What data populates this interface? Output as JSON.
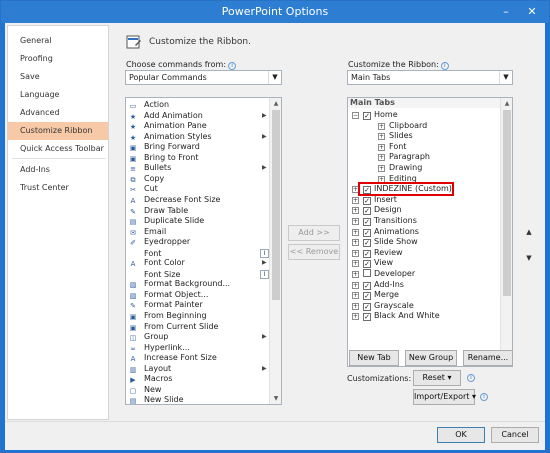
{
  "window": {
    "title": "PowerPoint Options",
    "minimize": "–",
    "close": "✕"
  },
  "sidebar": {
    "items": [
      {
        "label": "General"
      },
      {
        "label": "Proofing"
      },
      {
        "label": "Save"
      },
      {
        "label": "Language"
      },
      {
        "label": "Advanced"
      },
      {
        "label": "Customize Ribbon",
        "selected": true
      },
      {
        "label": "Quick Access Toolbar"
      },
      {
        "label": "Add-Ins"
      },
      {
        "label": "Trust Center"
      }
    ]
  },
  "main": {
    "heading": "Customize the Ribbon.",
    "choose_label": "Choose commands from:",
    "choose_value": "Popular Commands",
    "customize_label": "Customize the Ribbon:",
    "customize_value": "Main Tabs"
  },
  "commands": [
    {
      "label": "Action",
      "icon": "action-icon",
      "glyph": "▭"
    },
    {
      "label": "Add Animation",
      "icon": "star-icon",
      "glyph": "★",
      "submenu": true
    },
    {
      "label": "Animation Pane",
      "icon": "star-icon",
      "glyph": "★"
    },
    {
      "label": "Animation Styles",
      "icon": "star-icon",
      "glyph": "★",
      "submenu": true
    },
    {
      "label": "Bring Forward",
      "icon": "bring-forward-icon",
      "glyph": "▣"
    },
    {
      "label": "Bring to Front",
      "icon": "bring-front-icon",
      "glyph": "▣"
    },
    {
      "label": "Bullets",
      "icon": "bullets-icon",
      "glyph": "≡",
      "submenu": true
    },
    {
      "label": "Copy",
      "icon": "copy-icon",
      "glyph": "⧉"
    },
    {
      "label": "Cut",
      "icon": "scissors-icon",
      "glyph": "✂"
    },
    {
      "label": "Decrease Font Size",
      "icon": "decrease-font-icon",
      "glyph": "A"
    },
    {
      "label": "Draw Table",
      "icon": "pencil-icon",
      "glyph": "✎"
    },
    {
      "label": "Duplicate Slide",
      "icon": "slide-icon",
      "glyph": "▤"
    },
    {
      "label": "Email",
      "icon": "email-icon",
      "glyph": "✉"
    },
    {
      "label": "Eyedropper",
      "icon": "eyedropper-icon",
      "glyph": "✐"
    },
    {
      "label": "Font",
      "icon": "",
      "glyph": "",
      "control": "I"
    },
    {
      "label": "Font Color",
      "icon": "font-color-icon",
      "glyph": "A",
      "submenu": true
    },
    {
      "label": "Font Size",
      "icon": "",
      "glyph": "",
      "control": "I"
    },
    {
      "label": "Format Background...",
      "icon": "format-background-icon",
      "glyph": "▧"
    },
    {
      "label": "Format Object...",
      "icon": "format-object-icon",
      "glyph": "▧"
    },
    {
      "label": "Format Painter",
      "icon": "brush-icon",
      "glyph": "✎"
    },
    {
      "label": "From Beginning",
      "icon": "slideshow-icon",
      "glyph": "▣"
    },
    {
      "label": "From Current Slide",
      "icon": "slideshow-icon",
      "glyph": "▣"
    },
    {
      "label": "Group",
      "icon": "group-icon",
      "glyph": "◫",
      "submenu": true
    },
    {
      "label": "Hyperlink...",
      "icon": "link-icon",
      "glyph": "∞"
    },
    {
      "label": "Increase Font Size",
      "icon": "increase-font-icon",
      "glyph": "A"
    },
    {
      "label": "Layout",
      "icon": "layout-icon",
      "glyph": "▥",
      "submenu": true
    },
    {
      "label": "Macros",
      "icon": "macro-icon",
      "glyph": "▶"
    },
    {
      "label": "New",
      "icon": "new-icon",
      "glyph": "▢"
    },
    {
      "label": "New Slide",
      "icon": "slide-icon",
      "glyph": "▤"
    }
  ],
  "buttons": {
    "add": "Add >>",
    "remove": "<< Remove",
    "new_tab": "New Tab",
    "new_group": "New Group",
    "rename": "Rename...",
    "reset": "Reset",
    "import_export": "Import/Export",
    "ok": "OK",
    "cancel": "Cancel"
  },
  "customizations_label": "Customizations:",
  "tree": {
    "header": "Main Tabs",
    "rows": [
      {
        "label": "Home",
        "level": 0,
        "exp": "−",
        "checked": true
      },
      {
        "label": "Clipboard",
        "level": 1,
        "exp": "+"
      },
      {
        "label": "Slides",
        "level": 1,
        "exp": "+"
      },
      {
        "label": "Font",
        "level": 1,
        "exp": "+"
      },
      {
        "label": "Paragraph",
        "level": 1,
        "exp": "+"
      },
      {
        "label": "Drawing",
        "level": 1,
        "exp": "+"
      },
      {
        "label": "Editing",
        "level": 1,
        "exp": "+"
      },
      {
        "label": "INDEZINE (Custom)",
        "level": 0,
        "exp": "+",
        "checked": true,
        "highlight": true
      },
      {
        "label": "Insert",
        "level": 0,
        "exp": "+",
        "checked": true
      },
      {
        "label": "Design",
        "level": 0,
        "exp": "+",
        "checked": true
      },
      {
        "label": "Transitions",
        "level": 0,
        "exp": "+",
        "checked": true
      },
      {
        "label": "Animations",
        "level": 0,
        "exp": "+",
        "checked": true
      },
      {
        "label": "Slide Show",
        "level": 0,
        "exp": "+",
        "checked": true
      },
      {
        "label": "Review",
        "level": 0,
        "exp": "+",
        "checked": true
      },
      {
        "label": "View",
        "level": 0,
        "exp": "+",
        "checked": true
      },
      {
        "label": "Developer",
        "level": 0,
        "exp": "+",
        "checked": false
      },
      {
        "label": "Add-Ins",
        "level": 0,
        "exp": "+",
        "checked": true
      },
      {
        "label": "Merge",
        "level": 0,
        "exp": "+",
        "checked": true
      },
      {
        "label": "Grayscale",
        "level": 0,
        "exp": "+",
        "checked": true
      },
      {
        "label": "Black And White",
        "level": 0,
        "exp": "+",
        "checked": true
      }
    ]
  },
  "colors": {
    "accent": "#2d7dd2",
    "selected_nav": "#f8c9a6",
    "highlight_border": "#e00000"
  }
}
